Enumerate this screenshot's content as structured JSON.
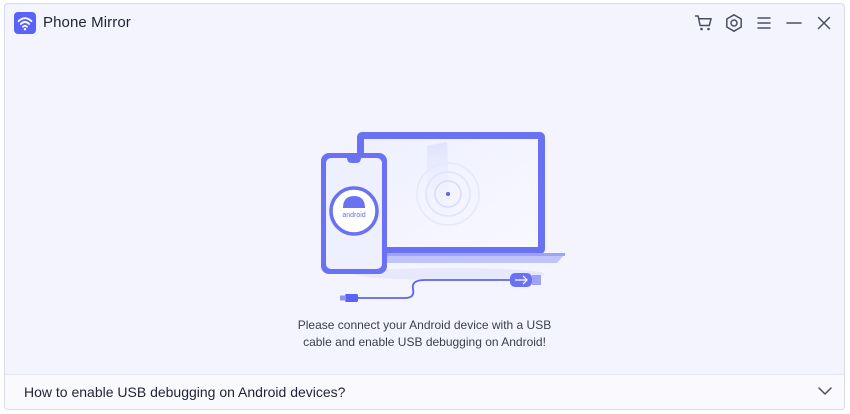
{
  "app": {
    "title": "Phone Mirror",
    "accent_color": "#5b63f5",
    "logo_icon": "wifi-mirror-icon"
  },
  "title_controls": [
    {
      "name": "cart-icon"
    },
    {
      "name": "settings-icon"
    },
    {
      "name": "menu-icon"
    },
    {
      "name": "minimize-icon"
    },
    {
      "name": "close-icon"
    }
  ],
  "illustration": {
    "phone_badge_text": "android"
  },
  "message": {
    "line1": "Please connect your Android device with a USB",
    "line2": "cable and enable USB debugging on Android!"
  },
  "faq": {
    "label": "How to enable USB debugging on Android devices?",
    "expand_icon": "chevron-down-icon"
  }
}
